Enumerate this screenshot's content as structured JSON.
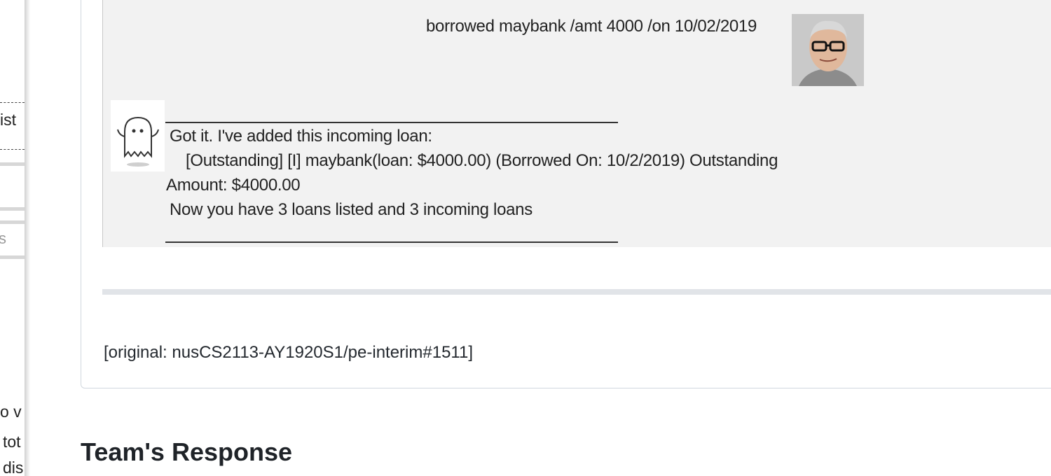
{
  "left_panel": {
    "texts": [
      "ist",
      "s",
      "o v",
      "tot",
      "dis"
    ]
  },
  "chat": {
    "user_message": "borrowed maybank /amt 4000 /on 10/02/2019",
    "bot_lines": [
      "Got it. I've added this incoming loan:",
      "[Outstanding] [I] maybank(loan: $4000.00) (Borrowed On: 10/2/2019) Outstanding",
      "Amount: $4000.00",
      "Now you have 3 loans listed and 3 incoming loans"
    ]
  },
  "original_ref": "[original: nusCS2113-AY1920S1/pe-interim#1511]",
  "section": {
    "title": "Team's Response"
  }
}
